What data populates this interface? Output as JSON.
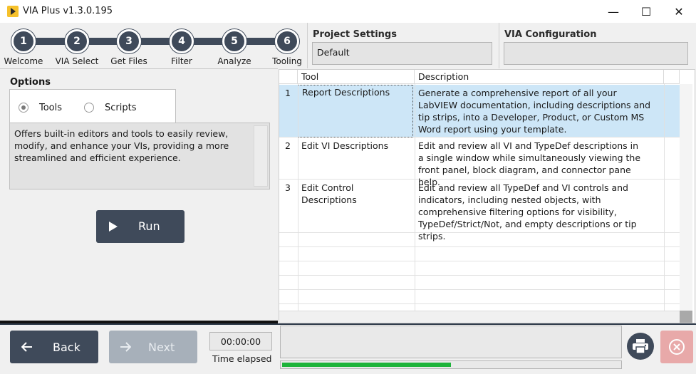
{
  "window": {
    "title": "VIA Plus v1.3.0.195",
    "minimize": "—",
    "maximize": "☐",
    "close": "✕"
  },
  "steps": [
    {
      "number": "1",
      "label": "Welcome"
    },
    {
      "number": "2",
      "label": "VIA Select"
    },
    {
      "number": "3",
      "label": "Get Files"
    },
    {
      "number": "4",
      "label": "Filter"
    },
    {
      "number": "5",
      "label": "Analyze"
    },
    {
      "number": "6",
      "label": "Tooling"
    }
  ],
  "project_settings": {
    "title": "Project Settings",
    "value": "Default"
  },
  "via_configuration": {
    "title": "VIA Configuration",
    "value": ""
  },
  "options": {
    "title": "Options",
    "radios": [
      {
        "label": "Tools",
        "selected": true
      },
      {
        "label": "Scripts",
        "selected": false
      }
    ],
    "description": "Offers built-in editors and tools to easily review, modify, and enhance your VIs, providing a more streamlined and efficient experience."
  },
  "run_button": {
    "label": "Run"
  },
  "table": {
    "columns": [
      "Tool",
      "Description"
    ],
    "rows": [
      {
        "index": "1",
        "tool": "Report Descriptions",
        "description": "Generate a comprehensive report of all your LabVIEW documentation, including descriptions and tip strips, into a Developer, Product, or Custom MS Word report using your template.",
        "selected": true
      },
      {
        "index": "2",
        "tool": "Edit VI Descriptions",
        "description": "Edit and review all VI and TypeDef descriptions in a single window while simultaneously viewing the front panel, block diagram, and connector pane help.",
        "selected": false
      },
      {
        "index": "3",
        "tool": "Edit Control Descriptions",
        "description": "Edit and review all TypeDef and VI controls and indicators, including nested objects, with comprehensive filtering options for visibility, TypeDef/Strict/Not, and empty descriptions or tip strips.",
        "selected": false
      }
    ]
  },
  "footer": {
    "back_label": "Back",
    "next_label": "Next",
    "time_value": "00:00:00",
    "time_label": "Time elapsed",
    "progress_fraction": 0.5
  },
  "colors": {
    "primary": "#3f4a5a",
    "selected_row": "#cde6f7",
    "progress": "#1db33a",
    "disabled_button": "#a7b0ba",
    "close_button": "#e8a9a9"
  }
}
